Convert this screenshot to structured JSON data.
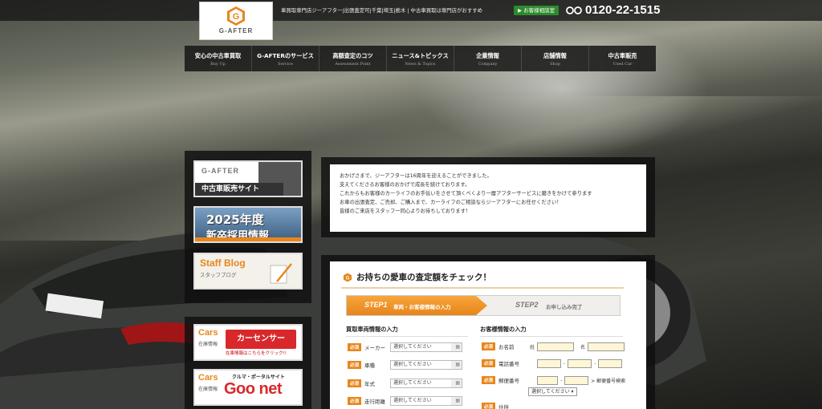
{
  "header": {
    "logo_text": "G-AFTER",
    "tagline": "車買取専門店ジーアフター|出張査定可|千葉|埼玉|栃木 | 中古車買取は専門店がおすすめ",
    "consult_label": "▶ お客様相談室",
    "phone": "0120-22-1515"
  },
  "nav": [
    {
      "jp": "安心の中古車買取",
      "en": "Buy Up"
    },
    {
      "jp": "G-AFTERのサービス",
      "en": "Service"
    },
    {
      "jp": "高額査定のコツ",
      "en": "Assessment Point"
    },
    {
      "jp": "ニュース&トピックス",
      "en": "News & Topics"
    },
    {
      "jp": "企業情報",
      "en": "Company"
    },
    {
      "jp": "店舗情報",
      "en": "Shop"
    },
    {
      "jp": "中古車販売",
      "en": "Used Car"
    }
  ],
  "sidebar": {
    "used_car_logo": "G-AFTER",
    "used_car_site": "中古車販売サイト",
    "recruit_line1": "2025年度",
    "recruit_line2": "新卒採用情報",
    "blog_title": "Staff Blog",
    "blog_sub": "スタッフブログ",
    "cars_label": "Cars",
    "stock_label": "在庫情報",
    "carsensor_name": "カーセンサー",
    "carsensor_sub": "在庫情報はこちらをクリック!!",
    "goonet_tag": "クルマ・ポータルサイト",
    "goonet_name": "Goo net"
  },
  "message": {
    "lines": [
      "おかげさまで、ジーアフターは16周年を迎えることができました。",
      "支えてくださるお客様のおかげで成長を続けております。",
      "これからもお客様のカーライフのお手伝いをさせて頂くべくより一層アフターサービスに磨きをかけて参ります",
      "お車の出張査定、ご売却、ご購入まで、カーライフのご相談ならジーアフターにお任せください！",
      "皆様のご来店をスタッフ一同心よりお待ちしております！"
    ]
  },
  "form": {
    "title": "お持ちの愛車の査定額をチェック！",
    "step1_no": "STEP1",
    "step1_label": "車両・お客様情報の入力",
    "step2_no": "STEP2",
    "step2_label": "お申し込み完了",
    "vehicle_head": "買取車両情報の入力",
    "customer_head": "お客様情報の入力",
    "required": "必須",
    "select_placeholder": "選択してください",
    "vehicle_fields": [
      "メーカー",
      "車種",
      "年式",
      "走行距離"
    ],
    "name_label": "お名前",
    "last_name": "姓",
    "first_name": "名",
    "tel_label": "電話番号",
    "zip_label": "郵便番号",
    "zip_search": "> 郵便番号検索",
    "pref_select": "選択してください",
    "address_label": "住所"
  }
}
